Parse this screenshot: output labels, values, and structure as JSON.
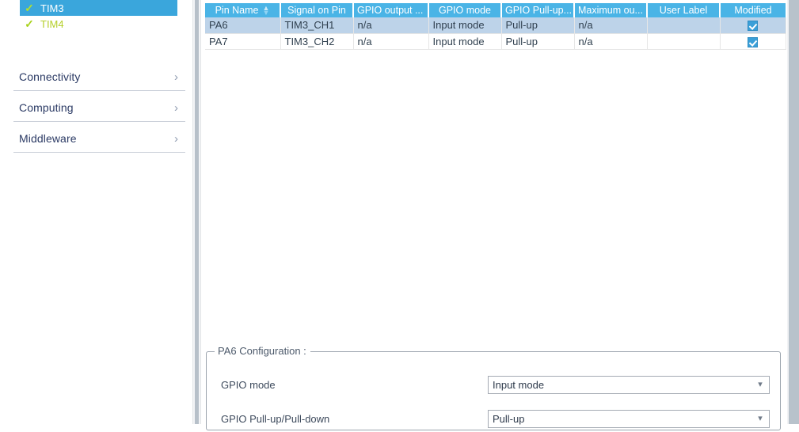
{
  "sidebar": {
    "peripherals": [
      {
        "label": "TIM3",
        "state_icon": "check-icon",
        "selected": true
      },
      {
        "label": "TIM4",
        "state_icon": "check-icon",
        "selected": false
      }
    ],
    "categories": [
      {
        "label": "Connectivity",
        "icon": "chevron-right-icon"
      },
      {
        "label": "Computing",
        "icon": "chevron-right-icon"
      },
      {
        "label": "Middleware",
        "icon": "chevron-right-icon"
      }
    ]
  },
  "pin_table": {
    "columns": [
      {
        "label": "Pin Name",
        "sort_icon": "sort-updown-icon",
        "sorted": true
      },
      {
        "label": "Signal on Pin"
      },
      {
        "label": "GPIO output ..."
      },
      {
        "label": "GPIO mode"
      },
      {
        "label": "GPIO Pull-up..."
      },
      {
        "label": "Maximum ou..."
      },
      {
        "label": "User Label"
      },
      {
        "label": "Modified"
      }
    ],
    "rows": [
      {
        "pin_name": "PA6",
        "signal_on_pin": "TIM3_CH1",
        "gpio_output": "n/a",
        "gpio_mode": "Input mode",
        "gpio_pullup": "Pull-up",
        "maximum_output": "n/a",
        "user_label": "",
        "modified": true,
        "selected": true
      },
      {
        "pin_name": "PA7",
        "signal_on_pin": "TIM3_CH2",
        "gpio_output": "n/a",
        "gpio_mode": "Input mode",
        "gpio_pullup": "Pull-up",
        "maximum_output": "n/a",
        "user_label": "",
        "modified": true,
        "selected": false
      }
    ]
  },
  "config_panel": {
    "title": "PA6 Configuration :",
    "fields": [
      {
        "label": "GPIO mode",
        "value": "Input mode",
        "icon": "chevron-down-icon"
      },
      {
        "label": "GPIO Pull-up/Pull-down",
        "value": "Pull-up",
        "icon": "chevron-down-icon"
      }
    ]
  },
  "colors": {
    "header_blue": "#4ab4e6",
    "selection_blue": "#3aa6dc",
    "row_selection": "#bdd3e9",
    "enabled_green": "#b5cf2a",
    "checkbox_blue": "#3a9fd8",
    "text_navy": "#2b3a64"
  }
}
